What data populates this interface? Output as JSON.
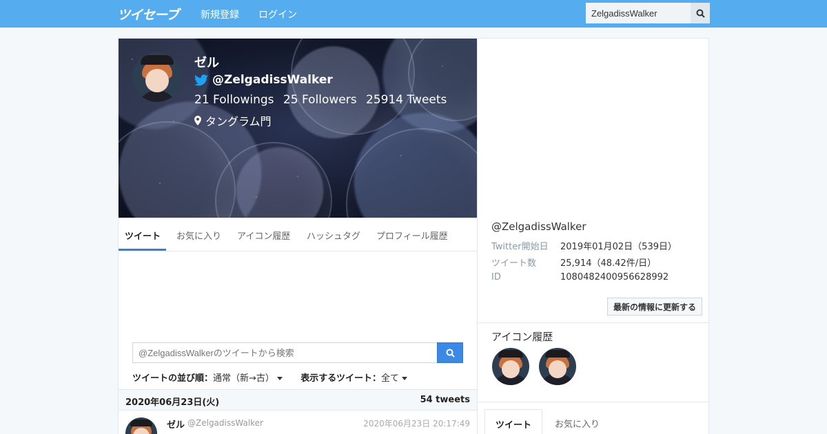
{
  "header": {
    "logo": "ツイセーブ",
    "nav_register": "新規登録",
    "nav_login": "ログイン",
    "search_value": "ZelgadissWalker"
  },
  "profile": {
    "name": "ゼル",
    "handle": "@ZelgadissWalker",
    "followings": "21 Followings",
    "followers": "25 Followers",
    "tweets": "25914 Tweets",
    "location": "タングラム門"
  },
  "tabs": [
    "ツイート",
    "お気に入り",
    "アイコン履歴",
    "ハッシュタグ",
    "プロフィール履歴"
  ],
  "tweet_search": {
    "placeholder": "@ZelgadissWalkerのツイートから検索"
  },
  "sort": {
    "order_label": "ツイートの並び順：",
    "order_value": "通常（新→古）",
    "filter_label": "表示するツイート：",
    "filter_value": "全て"
  },
  "date_group": {
    "date": "2020年06月23日(火)",
    "count": "54 tweets"
  },
  "tweet": {
    "user": "ゼル",
    "handle": "@ZelgadissWalker",
    "time": "2020年06月23日 20:17:49"
  },
  "info": {
    "handle": "@ZelgadissWalker",
    "rows": [
      {
        "label": "Twitter開始日",
        "value": "2019年01月02日（539日）"
      },
      {
        "label": "ツイート数",
        "value": "25,914（48.42件/日）"
      },
      {
        "label": "ID",
        "value": "1080482400956628992"
      }
    ],
    "refresh_label": "最新の情報に更新する"
  },
  "icon_history": {
    "title": "アイコン履歴"
  },
  "right_tabs": [
    "ツイート",
    "お気に入り"
  ],
  "colors": {
    "header": "#55acee",
    "accent": "#3b88e6",
    "twitter_blue": "#1da1f2"
  }
}
